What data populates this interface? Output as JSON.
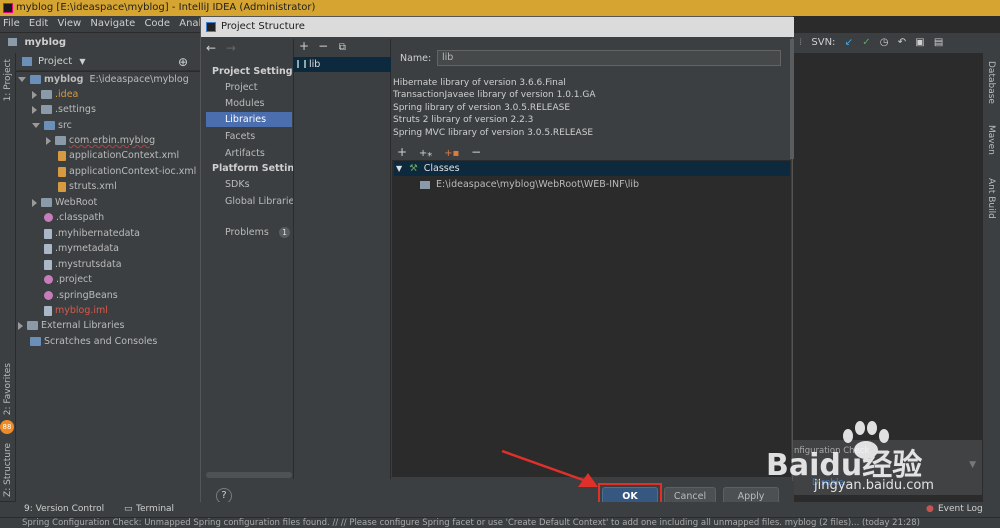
{
  "window": {
    "title": "myblog [E:\\ideaspace\\myblog] - IntelliJ IDEA (Administrator)"
  },
  "menu": [
    "File",
    "Edit",
    "View",
    "Navigate",
    "Code",
    "Analyze"
  ],
  "nav": {
    "project_name": "myblog"
  },
  "project_panel": {
    "header": "Project",
    "tab_label": "1: Project"
  },
  "tree": [
    {
      "label": "myblog",
      "path": "E:\\ideaspace\\myblog"
    },
    {
      "label": ".idea"
    },
    {
      "label": ".settings"
    },
    {
      "label": "src"
    },
    {
      "label": "com.erbin.myblog"
    },
    {
      "label": "applicationContext.xml"
    },
    {
      "label": "applicationContext-ioc.xml"
    },
    {
      "label": "struts.xml"
    },
    {
      "label": "WebRoot"
    },
    {
      "label": ".classpath"
    },
    {
      "label": ".myhibernatedata"
    },
    {
      "label": ".mymetadata"
    },
    {
      "label": ".mystrutsdata"
    },
    {
      "label": ".project"
    },
    {
      "label": ".springBeans"
    },
    {
      "label": "myblog.iml"
    },
    {
      "label": "External Libraries"
    },
    {
      "label": "Scratches and Consoles"
    }
  ],
  "left_tabs": {
    "favorites": "2: Favorites",
    "structure": "Z: Structure",
    "badge": "88"
  },
  "right_tabs": {
    "database": "Database",
    "maven": "Maven",
    "ant": "Ant Build"
  },
  "toolbar": {
    "svn": "SVN:"
  },
  "dialog": {
    "title": "Project Structure",
    "project_settings": "Project Settings",
    "platform_settings": "Platform Settings",
    "items_project": [
      "Project",
      "Modules",
      "Libraries",
      "Facets",
      "Artifacts"
    ],
    "items_platform": [
      "SDKs",
      "Global Libraries"
    ],
    "problems": "Problems",
    "problems_count": "1",
    "library": "lib",
    "name_label": "Name:",
    "name_value": "lib",
    "descriptions": [
      "Hibernate library of version 3.6.6.Final",
      "TransactionJavaee library of version 1.0.1.GA",
      "Spring library of version 3.0.5.RELEASE",
      "Struts 2 library of version 2.2.3",
      "Spring MVC library of version 3.0.5.RELEASE"
    ],
    "classes_label": "Classes",
    "classes_path": "E:\\ideaspace\\myblog\\WebRoot\\WEB-INF\\lib",
    "help": "?",
    "ok": "OK",
    "cancel": "Cancel",
    "apply": "Apply"
  },
  "popup": {
    "title": "nfiguration Check",
    "link": "Disable..."
  },
  "bottom_tabs": {
    "version_control": "9: Version Control",
    "terminal": "Terminal",
    "event_log": "Event Log"
  },
  "status": "Spring Configuration Check: Unmapped Spring configuration files found. // // Please configure Spring facet or use 'Create Default Context' to add one including all unmapped files. myblog (2 files)... (today 21:28)",
  "watermark": {
    "brand": "Baidu经验",
    "url": "jingyan.baidu.com"
  }
}
